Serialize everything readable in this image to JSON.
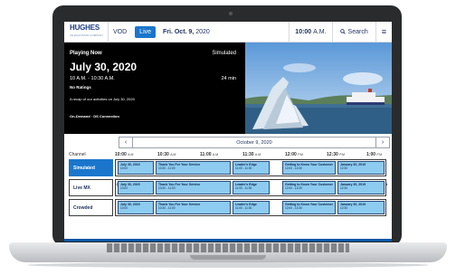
{
  "header": {
    "logo": "HUGHES",
    "logo_sub": "AN ECHOSTAR COMPANY",
    "tab_vod": "VOD",
    "tab_live": "Live",
    "date_day": "Fri. Oct. 9,",
    "date_year": "2020",
    "time": "10:00",
    "time_suffix": "A.M.",
    "search_label": "Search",
    "menu_glyph": "≡"
  },
  "hero": {
    "playing_label": "Playing Now",
    "mode": "Simulated",
    "title": "July 30, 2020",
    "time_range": "10 A.M. - 10:30 A.M.",
    "duration": "24 min",
    "rating": "No Ratings",
    "description": "A recap of our activities on July 30, 2020",
    "connection": "On-Demand  ·  DS Connection"
  },
  "date_nav": {
    "date": "October 9, 2020",
    "prev": "‹",
    "next": "›"
  },
  "guide": {
    "channel_header": "Channel",
    "times": [
      {
        "t": "10:00",
        "ap": "A.M"
      },
      {
        "t": "10:30",
        "ap": "A.M"
      },
      {
        "t": "11:00",
        "ap": "A.M"
      },
      {
        "t": "11:30",
        "ap": "A.M"
      },
      {
        "t": "12:00",
        "ap": "P.M"
      },
      {
        "t": "12:30",
        "ap": "P.M"
      },
      {
        "t": "1:00",
        "ap": "P.M"
      }
    ],
    "channels": [
      "Simulated",
      "Live MX",
      "Crowded"
    ],
    "programs": [
      {
        "title": "July 30, 2019",
        "time": "10:00"
      },
      {
        "title": "Thank You For Your Service",
        "time": "10:30 - 11:00"
      },
      {
        "title": "Leader's Edge",
        "time": "11:00 - 11:30"
      },
      {
        "title": "Getting to Know Your Customer",
        "time": "12:00 - 12:30"
      },
      {
        "title": "January 30, 2019",
        "time": "12:30"
      }
    ],
    "left_arrow": "‹",
    "right_arrow": "›"
  }
}
